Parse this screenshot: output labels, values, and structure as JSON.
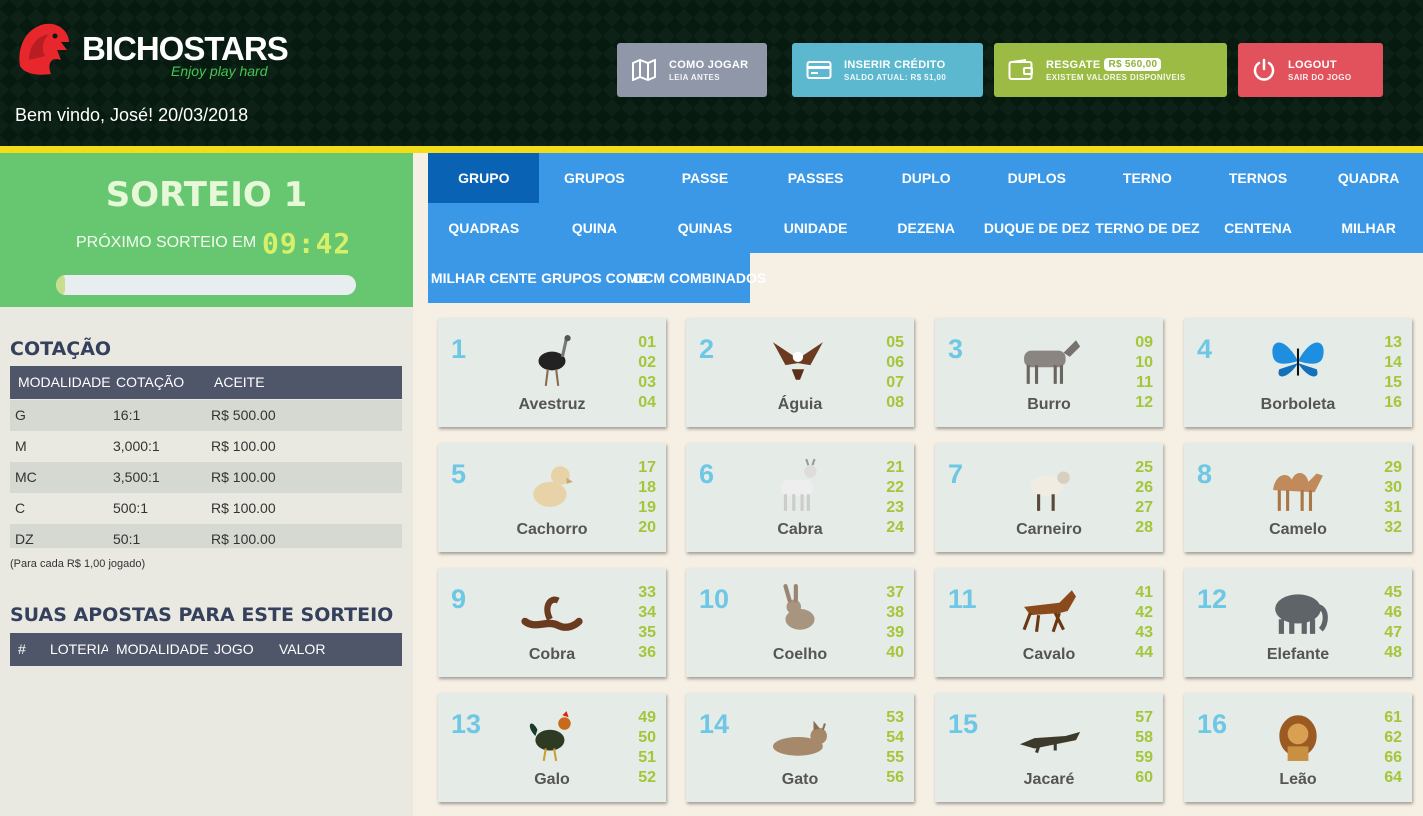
{
  "brand": {
    "name": "BICHOSTARS",
    "tagline": "Enjoy play hard",
    "accent": "#e8272d"
  },
  "welcome": "Bem vindo, José! 20/03/2018",
  "header_buttons": [
    {
      "title": "COMO JOGAR",
      "subtitle": "LEIA ANTES",
      "icon": "map-icon",
      "color": "#8f97a8"
    },
    {
      "title": "INSERIR CRÉDITO",
      "subtitle": "SALDO ATUAL: R$ 51,00",
      "icon": "credit-card-icon",
      "color": "#5bb8cf"
    },
    {
      "title": "RESGATE",
      "badge": "R$ 560,00",
      "subtitle": "EXISTEM VALORES DISPONÍVEIS",
      "icon": "wallet-icon",
      "color": "#9bbb44"
    },
    {
      "title": "LOGOUT",
      "subtitle": "SAIR DO JOGO",
      "icon": "power-icon",
      "color": "#e2525c"
    }
  ],
  "sorteio": {
    "title": "SORTEIO 1",
    "next_label": "PRÓXIMO SORTEIO EM",
    "timer": "09:42",
    "progress": 0.03
  },
  "cotacao": {
    "title": "COTAÇÃO",
    "headers": [
      "MODALIDADE",
      "COTAÇÃO",
      "ACEITE"
    ],
    "rows": [
      [
        "G",
        "16:1",
        "R$ 500.00"
      ],
      [
        "M",
        "3,000:1",
        "R$ 100.00"
      ],
      [
        "MC",
        "3,500:1",
        "R$ 100.00"
      ],
      [
        "C",
        "500:1",
        "R$ 100.00"
      ],
      [
        "DZ",
        "50:1",
        "R$ 100.00"
      ]
    ],
    "note": "(Para cada R$ 1,00 jogado)"
  },
  "apostas": {
    "title": "SUAS APOSTAS PARA ESTE SORTEIO",
    "headers": [
      "#",
      "LOTERIA",
      "MODALIDADE",
      "JOGO",
      "VALOR"
    ]
  },
  "nav": {
    "active": "GRUPO",
    "items": [
      "GRUPO",
      "GRUPOS",
      "PASSE",
      "PASSES",
      "DUPLO",
      "DUPLOS",
      "TERNO",
      "TERNOS",
      "QUADRA",
      "QUADRAS",
      "QUINA",
      "QUINAS",
      "UNIDADE",
      "DEZENA",
      "DUQUE DE DEZ",
      "TERNO DE DEZ",
      "CENTENA",
      "MILHAR",
      "MILHAR CENTE",
      "GRUPOS COME",
      "DCM COMBINADOS"
    ]
  },
  "animals": [
    {
      "n": "1",
      "name": "Avestruz",
      "nums": [
        "01",
        "02",
        "03",
        "04"
      ],
      "icon": "ostrich-icon"
    },
    {
      "n": "2",
      "name": "Águia",
      "nums": [
        "05",
        "06",
        "07",
        "08"
      ],
      "icon": "eagle-icon"
    },
    {
      "n": "3",
      "name": "Burro",
      "nums": [
        "09",
        "10",
        "11",
        "12"
      ],
      "icon": "donkey-icon"
    },
    {
      "n": "4",
      "name": "Borboleta",
      "nums": [
        "13",
        "14",
        "15",
        "16"
      ],
      "icon": "butterfly-icon"
    },
    {
      "n": "5",
      "name": "Cachorro",
      "nums": [
        "17",
        "18",
        "19",
        "20"
      ],
      "icon": "dog-icon"
    },
    {
      "n": "6",
      "name": "Cabra",
      "nums": [
        "21",
        "22",
        "23",
        "24"
      ],
      "icon": "goat-icon"
    },
    {
      "n": "7",
      "name": "Carneiro",
      "nums": [
        "25",
        "26",
        "27",
        "28"
      ],
      "icon": "sheep-icon"
    },
    {
      "n": "8",
      "name": "Camelo",
      "nums": [
        "29",
        "30",
        "31",
        "32"
      ],
      "icon": "camel-icon"
    },
    {
      "n": "9",
      "name": "Cobra",
      "nums": [
        "33",
        "34",
        "35",
        "36"
      ],
      "icon": "snake-icon"
    },
    {
      "n": "10",
      "name": "Coelho",
      "nums": [
        "37",
        "38",
        "39",
        "40"
      ],
      "icon": "rabbit-icon"
    },
    {
      "n": "11",
      "name": "Cavalo",
      "nums": [
        "41",
        "42",
        "43",
        "44"
      ],
      "icon": "horse-icon"
    },
    {
      "n": "12",
      "name": "Elefante",
      "nums": [
        "45",
        "46",
        "47",
        "48"
      ],
      "icon": "elephant-icon"
    },
    {
      "n": "13",
      "name": "Galo",
      "nums": [
        "49",
        "50",
        "51",
        "52"
      ],
      "icon": "rooster-icon"
    },
    {
      "n": "14",
      "name": "Gato",
      "nums": [
        "53",
        "54",
        "55",
        "56"
      ],
      "icon": "cat-icon"
    },
    {
      "n": "15",
      "name": "Jacaré",
      "nums": [
        "57",
        "58",
        "59",
        "60"
      ],
      "icon": "alligator-icon"
    },
    {
      "n": "16",
      "name": "Leão",
      "nums": [
        "61",
        "62",
        "66",
        "64"
      ],
      "icon": "lion-icon"
    }
  ]
}
